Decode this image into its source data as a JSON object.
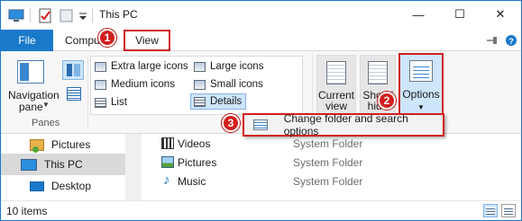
{
  "window": {
    "title": "This PC"
  },
  "tabs": {
    "file": "File",
    "computer": "Computer",
    "view": "View"
  },
  "callouts": [
    "1",
    "2",
    "3"
  ],
  "ribbon": {
    "nav_pane_line1": "Navigation",
    "nav_pane_line2": "pane",
    "panes_group": "Panes",
    "layout_items": {
      "extra_large": "Extra large icons",
      "large": "Large icons",
      "medium": "Medium icons",
      "small": "Small icons",
      "list": "List",
      "details": "Details"
    },
    "current_view_line1": "Current",
    "current_view_line2": "view",
    "show_hide_line1": "Show/",
    "show_hide_line2": "hide",
    "options": "Options"
  },
  "dropdown": {
    "change_options": "Change folder and search options"
  },
  "nav_items": {
    "pictures": "Pictures",
    "this_pc": "This PC",
    "desktop": "Desktop"
  },
  "files": [
    {
      "name": "Videos",
      "type": "System Folder"
    },
    {
      "name": "Pictures",
      "type": "System Folder"
    },
    {
      "name": "Music",
      "type": "System Folder"
    }
  ],
  "status": {
    "items": "10 items"
  },
  "colors": {
    "accent": "#1979ca",
    "callout": "#d21e1e",
    "selection": "#cde6fb"
  }
}
